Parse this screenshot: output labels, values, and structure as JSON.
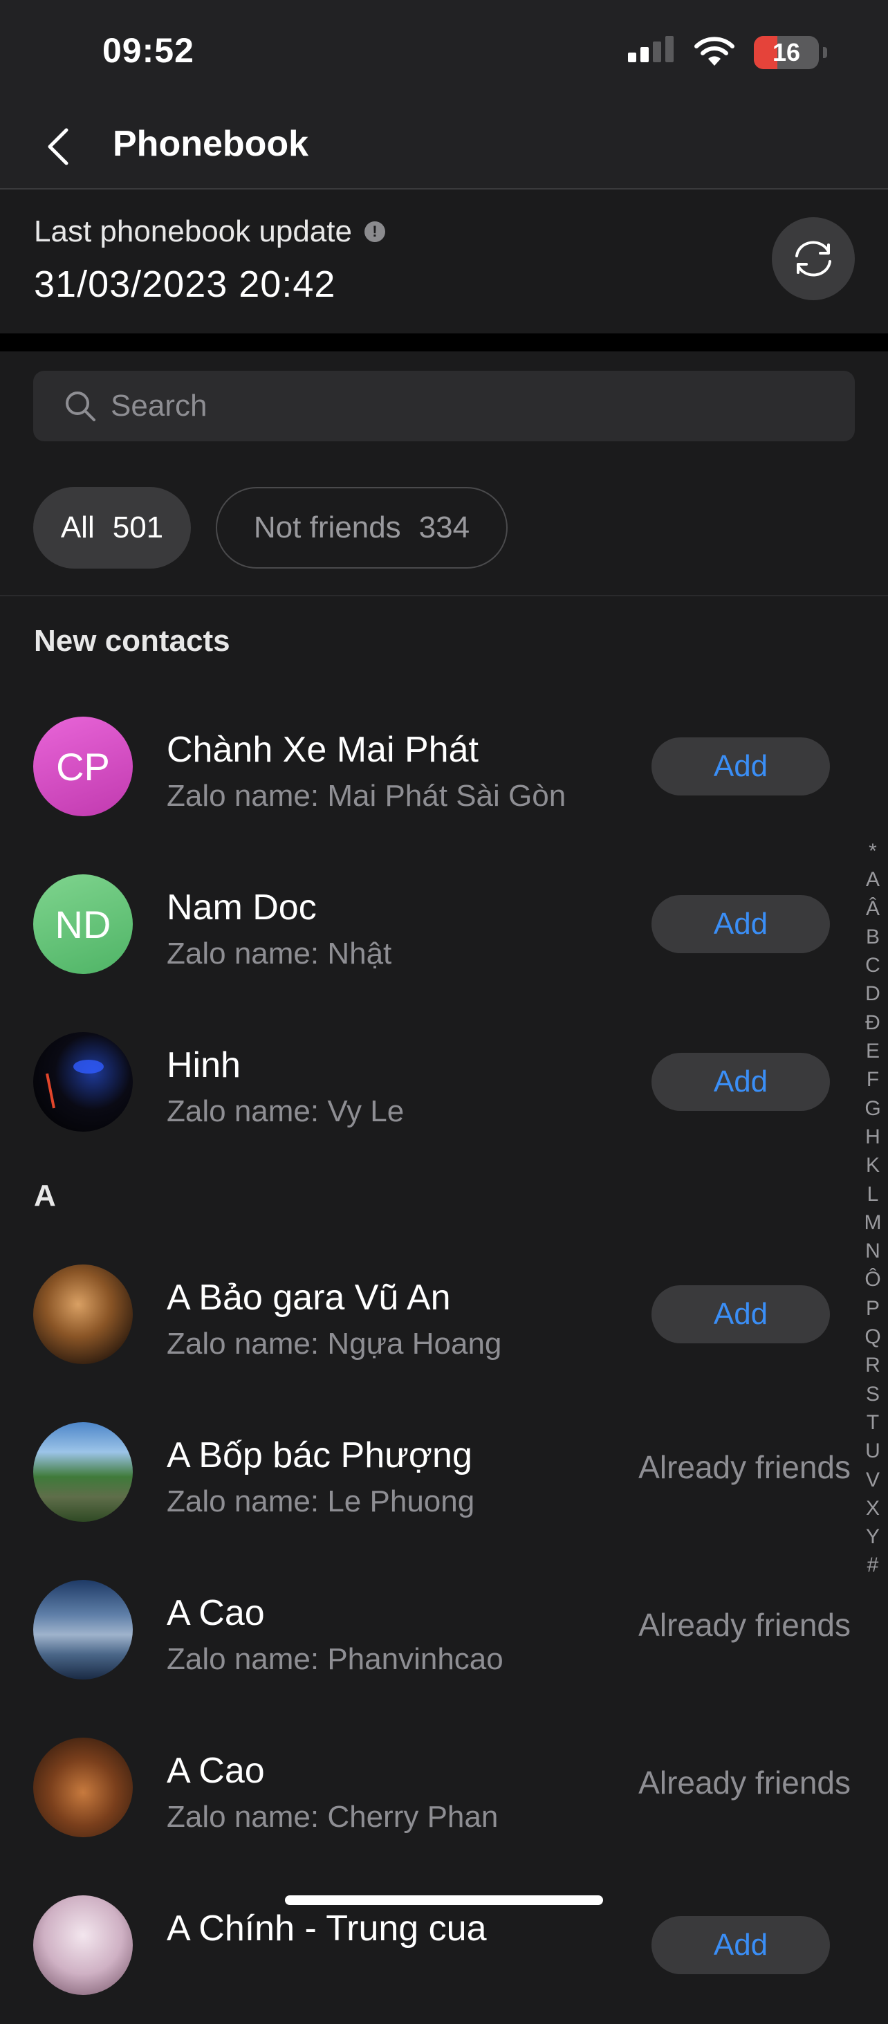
{
  "status_bar": {
    "time": "09:52",
    "battery": "16",
    "battery_color": "#e5433a"
  },
  "nav": {
    "title": "Phonebook"
  },
  "update": {
    "label": "Last phonebook update",
    "timestamp": "31/03/2023 20:42"
  },
  "search": {
    "placeholder": "Search"
  },
  "filters": [
    {
      "label": "All",
      "count": "501",
      "selected": true
    },
    {
      "label": "Not friends",
      "count": "334",
      "selected": false
    }
  ],
  "sections": {
    "new_contacts": "New contacts",
    "a": "A"
  },
  "contacts": [
    {
      "name": "Chành Xe Mai Phát",
      "sub": "Zalo name: Mai Phát Sài Gòn",
      "initials": "CP",
      "action": "Add"
    },
    {
      "name": "Nam Doc",
      "sub": "Zalo name: Nhật",
      "initials": "ND",
      "action": "Add"
    },
    {
      "name": "Hinh",
      "sub": "Zalo name: Vy Le",
      "initials": "",
      "action": "Add"
    },
    {
      "name": "A Bảo gara Vũ An",
      "sub": "Zalo name: Ngựa Hoang",
      "initials": "",
      "action": "Add"
    },
    {
      "name": "A Bốp bác Phượng",
      "sub": "Zalo name: Le Phuong",
      "initials": "",
      "action": "Already friends"
    },
    {
      "name": "A Cao",
      "sub": "Zalo name: Phanvinhcao",
      "initials": "",
      "action": "Already friends"
    },
    {
      "name": "A Cao",
      "sub": "Zalo name: Cherry Phan",
      "initials": "",
      "action": "Already friends"
    },
    {
      "name": "A Chính - Trung cua",
      "sub": "",
      "initials": "",
      "action": "Add"
    }
  ],
  "index_letters": [
    "*",
    "A",
    "Â",
    "B",
    "C",
    "D",
    "Đ",
    "E",
    "F",
    "G",
    "H",
    "K",
    "L",
    "M",
    "N",
    "Ô",
    "P",
    "Q",
    "R",
    "S",
    "T",
    "U",
    "V",
    "X",
    "Y",
    "#"
  ],
  "colors": {
    "accent": "#3a8ef6",
    "background": "#1b1b1c",
    "button": "#3a3a3c"
  }
}
